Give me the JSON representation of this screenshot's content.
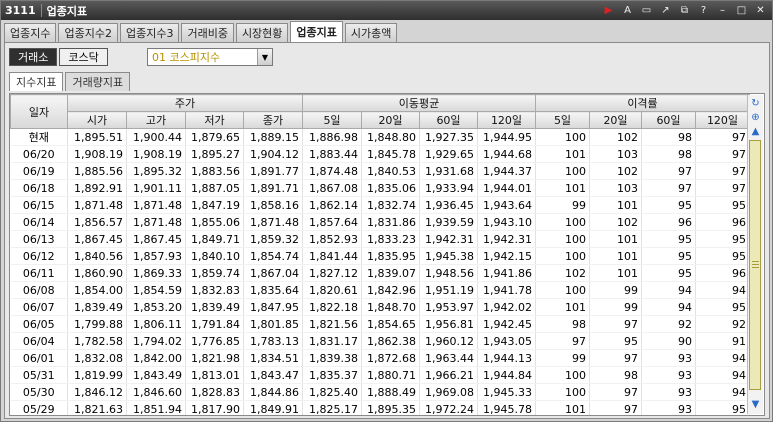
{
  "window": {
    "code": "3111",
    "title": "업종지표",
    "icons": [
      "play-icon",
      "font-icon",
      "memo-icon",
      "link-icon",
      "restore-icon",
      "help-icon",
      "minimize-icon",
      "maximize-icon",
      "close-icon"
    ]
  },
  "tabs": [
    "업종지수",
    "업종지수2",
    "업종지수3",
    "거래비중",
    "시장현황",
    "업종지표",
    "시가총액"
  ],
  "active_tab": "업종지표",
  "market": {
    "selected": "거래소",
    "other": "코스닥"
  },
  "sector_combo": {
    "value": "01 코스피지수"
  },
  "subtabs": [
    "지수지표",
    "거래량지표"
  ],
  "active_subtab": "지수지표",
  "table": {
    "date_header": "일자",
    "groups": [
      "주가",
      "이동평균",
      "이격률"
    ],
    "price_cols": [
      "시가",
      "고가",
      "저가",
      "종가"
    ],
    "ma_cols": [
      "5일",
      "20일",
      "60일",
      "120일"
    ],
    "div_cols": [
      "5일",
      "20일",
      "60일",
      "120일"
    ],
    "rows": [
      [
        "현재",
        "1,895.51",
        "1,900.44",
        "1,879.65",
        "1,889.15",
        "1,886.98",
        "1,848.80",
        "1,927.35",
        "1,944.95",
        "100",
        "102",
        "98",
        "97"
      ],
      [
        "06/20",
        "1,908.19",
        "1,908.19",
        "1,895.27",
        "1,904.12",
        "1,883.44",
        "1,845.78",
        "1,929.65",
        "1,944.68",
        "101",
        "103",
        "98",
        "97"
      ],
      [
        "06/19",
        "1,885.56",
        "1,895.32",
        "1,883.56",
        "1,891.77",
        "1,874.48",
        "1,840.53",
        "1,931.68",
        "1,944.37",
        "100",
        "102",
        "97",
        "97"
      ],
      [
        "06/18",
        "1,892.91",
        "1,901.11",
        "1,887.05",
        "1,891.71",
        "1,867.08",
        "1,835.06",
        "1,933.94",
        "1,944.01",
        "101",
        "103",
        "97",
        "97"
      ],
      [
        "06/15",
        "1,871.48",
        "1,871.48",
        "1,847.19",
        "1,858.16",
        "1,862.14",
        "1,832.74",
        "1,936.45",
        "1,943.64",
        "99",
        "101",
        "95",
        "95"
      ],
      [
        "06/14",
        "1,856.57",
        "1,871.48",
        "1,855.06",
        "1,871.48",
        "1,857.64",
        "1,831.86",
        "1,939.59",
        "1,943.10",
        "100",
        "102",
        "96",
        "96"
      ],
      [
        "06/13",
        "1,867.45",
        "1,867.45",
        "1,849.71",
        "1,859.32",
        "1,852.93",
        "1,833.23",
        "1,942.31",
        "1,942.31",
        "100",
        "101",
        "95",
        "95"
      ],
      [
        "06/12",
        "1,840.56",
        "1,857.93",
        "1,840.10",
        "1,854.74",
        "1,841.44",
        "1,835.95",
        "1,945.38",
        "1,942.15",
        "100",
        "101",
        "95",
        "95"
      ],
      [
        "06/11",
        "1,860.90",
        "1,869.33",
        "1,859.74",
        "1,867.04",
        "1,827.12",
        "1,839.07",
        "1,948.56",
        "1,941.86",
        "102",
        "101",
        "95",
        "96"
      ],
      [
        "06/08",
        "1,854.00",
        "1,854.59",
        "1,832.83",
        "1,835.64",
        "1,820.61",
        "1,842.96",
        "1,951.19",
        "1,941.78",
        "100",
        "99",
        "94",
        "94"
      ],
      [
        "06/07",
        "1,839.49",
        "1,853.20",
        "1,839.49",
        "1,847.95",
        "1,822.18",
        "1,848.70",
        "1,953.97",
        "1,942.02",
        "101",
        "99",
        "94",
        "95"
      ],
      [
        "06/05",
        "1,799.88",
        "1,806.11",
        "1,791.84",
        "1,801.85",
        "1,821.56",
        "1,854.65",
        "1,956.81",
        "1,942.45",
        "98",
        "97",
        "92",
        "92"
      ],
      [
        "06/04",
        "1,782.58",
        "1,794.02",
        "1,776.85",
        "1,783.13",
        "1,831.17",
        "1,862.38",
        "1,960.12",
        "1,943.05",
        "97",
        "95",
        "90",
        "91"
      ],
      [
        "06/01",
        "1,832.08",
        "1,842.00",
        "1,821.98",
        "1,834.51",
        "1,839.38",
        "1,872.68",
        "1,963.44",
        "1,944.13",
        "99",
        "97",
        "93",
        "94"
      ],
      [
        "05/31",
        "1,819.99",
        "1,843.49",
        "1,813.01",
        "1,843.47",
        "1,835.37",
        "1,880.71",
        "1,966.21",
        "1,944.84",
        "100",
        "98",
        "93",
        "94"
      ],
      [
        "05/30",
        "1,846.12",
        "1,846.60",
        "1,828.83",
        "1,844.86",
        "1,825.40",
        "1,888.49",
        "1,969.08",
        "1,945.33",
        "100",
        "97",
        "93",
        "94"
      ],
      [
        "05/29",
        "1,821.63",
        "1,851.94",
        "1,817.90",
        "1,849.91",
        "1,825.17",
        "1,895.35",
        "1,972.24",
        "1,945.78",
        "101",
        "97",
        "93",
        "95"
      ]
    ]
  }
}
